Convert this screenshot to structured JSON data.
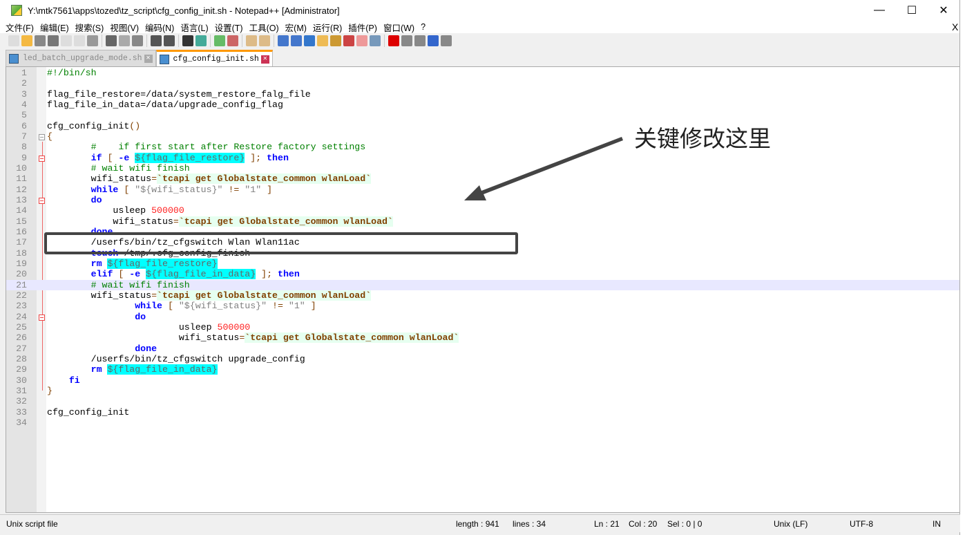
{
  "window": {
    "title": "Y:\\mtk7561\\apps\\tozed\\tz_script\\cfg_config_init.sh - Notepad++ [Administrator]",
    "minimize": "—",
    "maximize": "☐",
    "close": "✕"
  },
  "menu": [
    "文件(F)",
    "编辑(E)",
    "搜索(S)",
    "视图(V)",
    "编码(N)",
    "语言(L)",
    "设置(T)",
    "工具(O)",
    "宏(M)",
    "运行(R)",
    "插件(P)",
    "窗口(W)",
    "?"
  ],
  "menu_close": "X",
  "tabs": [
    {
      "label": "led_batch_upgrade_mode.sh",
      "active": false
    },
    {
      "label": "cfg_config_init.sh",
      "active": true
    }
  ],
  "current_line": 21,
  "lines": [
    [
      [
        "c",
        "#!/bin/sh"
      ]
    ],
    [],
    [
      [
        "p",
        "flag_file_restore=/data/system_restore_falg_file"
      ]
    ],
    [
      [
        "p",
        "flag_file_in_data=/data/upgrade_config_flag"
      ]
    ],
    [],
    [
      [
        "p",
        "cfg_config_init"
      ],
      [
        "o",
        "()"
      ]
    ],
    [
      [
        "o",
        "{"
      ]
    ],
    [
      [
        "c",
        "\t#    if first start after Restore factory settings"
      ]
    ],
    [
      [
        "k",
        "\tif "
      ],
      [
        "o",
        "[ "
      ],
      [
        "k",
        "-e "
      ],
      [
        "v",
        "${flag_file_restore}"
      ],
      [
        "o",
        " ]; "
      ],
      [
        "k",
        "then"
      ]
    ],
    [
      [
        "c",
        "\t# wait wifi finish"
      ]
    ],
    [
      [
        "p",
        "\twifi_status"
      ],
      [
        "o",
        "="
      ],
      [
        "bt",
        "`tcapi get Globalstate_common wlanLoad`"
      ]
    ],
    [
      [
        "k",
        "\twhile "
      ],
      [
        "o",
        "[ "
      ],
      [
        "s",
        "\"${wifi_status}\""
      ],
      [
        "o",
        " != "
      ],
      [
        "s",
        "\"1\""
      ],
      [
        "o",
        " ]"
      ]
    ],
    [
      [
        "k",
        "\tdo"
      ]
    ],
    [
      [
        "p",
        "\t    usleep "
      ],
      [
        "n",
        "500000"
      ]
    ],
    [
      [
        "p",
        "\t    wifi_status"
      ],
      [
        "o",
        "="
      ],
      [
        "bt",
        "`tcapi get Globalstate_common wlanLoad`"
      ]
    ],
    [
      [
        "k",
        "\tdone"
      ]
    ],
    [
      [
        "p",
        "\t/userfs/bin/tz_cfgswitch Wlan Wlan11ac"
      ]
    ],
    [
      [
        "k",
        "\ttouch "
      ],
      [
        "p",
        "/tmp/.cfg_config_finish"
      ]
    ],
    [
      [
        "k",
        "\trm "
      ],
      [
        "v",
        "${flag_file_restore}"
      ]
    ],
    [
      [
        "k",
        "\telif "
      ],
      [
        "o",
        "[ "
      ],
      [
        "k",
        "-e "
      ],
      [
        "v",
        "${flag_file_in_data}"
      ],
      [
        "o",
        " ]; "
      ],
      [
        "k",
        "then"
      ]
    ],
    [
      [
        "c",
        "\t# wait wifi finish"
      ]
    ],
    [
      [
        "p",
        "\twifi_status"
      ],
      [
        "o",
        "="
      ],
      [
        "bt",
        "`tcapi get Globalstate_common wlanLoad`"
      ]
    ],
    [
      [
        "k",
        "\t\twhile "
      ],
      [
        "o",
        "[ "
      ],
      [
        "s",
        "\"${wifi_status}\""
      ],
      [
        "o",
        " != "
      ],
      [
        "s",
        "\"1\""
      ],
      [
        "o",
        " ]"
      ]
    ],
    [
      [
        "k",
        "\t\tdo"
      ]
    ],
    [
      [
        "p",
        "\t\t\tusleep "
      ],
      [
        "n",
        "500000"
      ]
    ],
    [
      [
        "p",
        "\t\t\twifi_status"
      ],
      [
        "o",
        "="
      ],
      [
        "bt",
        "`tcapi get Globalstate_common wlanLoad`"
      ]
    ],
    [
      [
        "k",
        "\t\tdone"
      ]
    ],
    [
      [
        "p",
        "\t/userfs/bin/tz_cfgswitch upgrade_config"
      ]
    ],
    [
      [
        "k",
        "\trm "
      ],
      [
        "v",
        "${flag_file_in_data}"
      ]
    ],
    [
      [
        "k",
        "    fi"
      ]
    ],
    [
      [
        "o",
        "}"
      ]
    ],
    [],
    [
      [
        "p",
        "cfg_config_init"
      ]
    ],
    []
  ],
  "fold_markers": [
    {
      "line": 7,
      "type": "gray"
    },
    {
      "line": 9,
      "type": "red"
    },
    {
      "line": 13,
      "type": "red"
    },
    {
      "line": 24,
      "type": "red"
    }
  ],
  "status": {
    "file_type": "Unix script file",
    "length": "length : 941",
    "lines": "lines : 34",
    "ln": "Ln : 21",
    "col": "Col : 20",
    "sel": "Sel : 0 | 0",
    "eol": "Unix (LF)",
    "encoding": "UTF-8",
    "ins": "IN"
  },
  "annotation": {
    "text": "关键修改这里",
    "highlighted_line": 17
  }
}
